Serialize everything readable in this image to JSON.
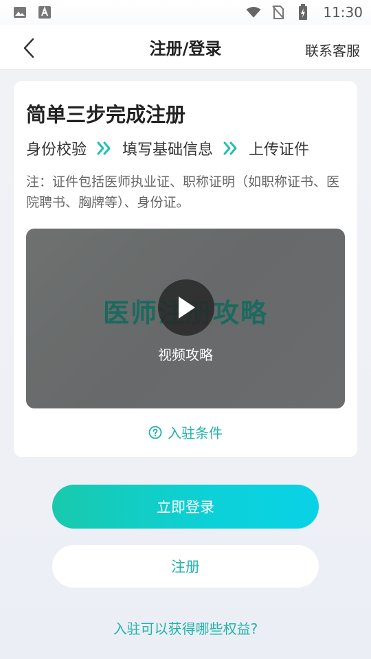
{
  "status_bar": {
    "time": "11:30",
    "icons": [
      "image-icon",
      "font-icon",
      "wifi-icon",
      "no-sim-icon",
      "battery-charging-icon"
    ]
  },
  "header": {
    "title": "注册/登录",
    "contact": "联系客服"
  },
  "card": {
    "title": "简单三步完成注册",
    "steps": [
      "身份校验",
      "填写基础信息",
      "上传证件"
    ],
    "note": "注：证件包括医师执业证、职称证明（如职称证书、医院聘书、胸牌等）、身份证。",
    "video": {
      "background_text": "医师注册攻略",
      "label": "视频攻略"
    },
    "conditions": "入驻条件"
  },
  "actions": {
    "login": "立即登录",
    "register": "注册",
    "benefits": "入驻可以获得哪些权益?"
  },
  "colors": {
    "accent": "#1fb4a8",
    "gradient_start": "#19c9ad",
    "gradient_end": "#0ad2e6"
  }
}
